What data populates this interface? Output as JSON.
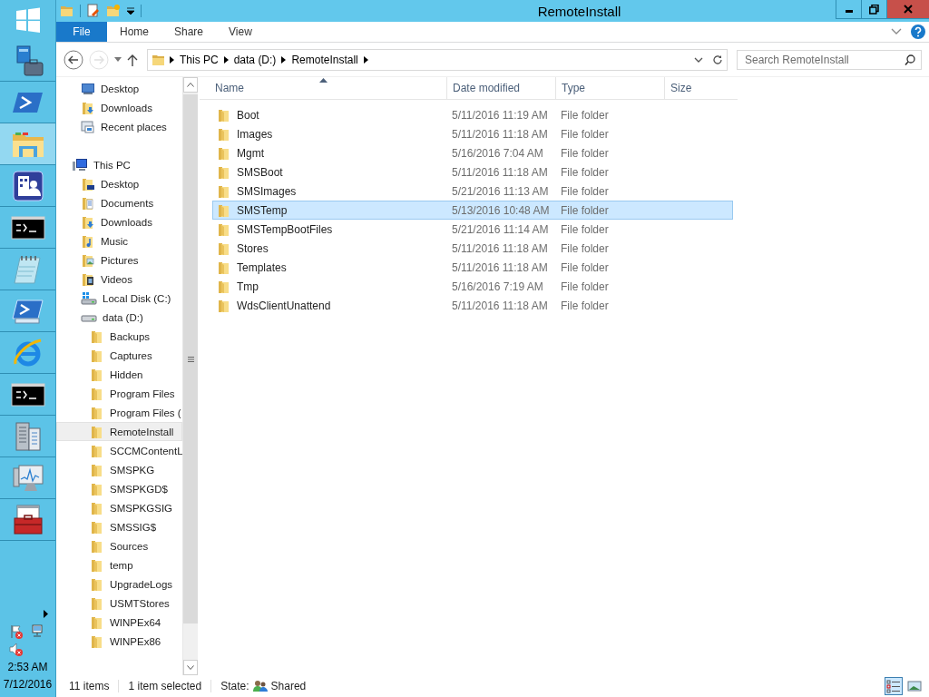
{
  "taskbar": {
    "items": [
      {
        "kind": "start",
        "selected": false
      },
      {
        "kind": "server-manager",
        "selected": false
      },
      {
        "kind": "powershell",
        "selected": false
      },
      {
        "kind": "explorer",
        "selected": true
      },
      {
        "kind": "users",
        "selected": false
      },
      {
        "kind": "cmd",
        "selected": false
      },
      {
        "kind": "notepad",
        "selected": false
      },
      {
        "kind": "powershell-ise",
        "selected": false
      },
      {
        "kind": "browser",
        "selected": false
      },
      {
        "kind": "cmd",
        "selected": false
      },
      {
        "kind": "server",
        "selected": false
      },
      {
        "kind": "monitor",
        "selected": false
      },
      {
        "kind": "toolbox",
        "selected": false
      }
    ],
    "tray": {
      "time": "2:53 AM",
      "date": "7/12/2016"
    }
  },
  "window": {
    "title": "RemoteInstall"
  },
  "ribbon": {
    "tabs": [
      {
        "label": "File",
        "kind": "file",
        "selected": false
      },
      {
        "label": "Home",
        "kind": "tab",
        "selected": false
      },
      {
        "label": "Share",
        "kind": "tab",
        "selected": false
      },
      {
        "label": "View",
        "kind": "tab",
        "selected": false
      }
    ]
  },
  "address": {
    "nav_buttons": [
      {
        "kind": "back",
        "disabled": false
      },
      {
        "kind": "forward",
        "disabled": true
      },
      {
        "kind": "recent",
        "disabled": false
      },
      {
        "kind": "up",
        "disabled": false
      }
    ],
    "breadcrumbs": [
      "This PC",
      "data (D:)",
      "RemoteInstall"
    ],
    "search": {
      "placeholder": "Search RemoteInstall"
    }
  },
  "navigation": {
    "quick_items": [
      {
        "label": "Desktop",
        "kind": "desktop",
        "selected": false
      },
      {
        "label": "Downloads",
        "kind": "downloads",
        "selected": false
      },
      {
        "label": "Recent places",
        "kind": "recent",
        "selected": false
      }
    ],
    "tree": [
      {
        "label": "This PC",
        "kind": "pc",
        "selected": false,
        "children": [
          {
            "label": "Desktop",
            "kind": "desktop-folder",
            "selected": false
          },
          {
            "label": "Documents",
            "kind": "documents",
            "selected": false
          },
          {
            "label": "Downloads",
            "kind": "downloads",
            "selected": false
          },
          {
            "label": "Music",
            "kind": "music",
            "selected": false
          },
          {
            "label": "Pictures",
            "kind": "pictures",
            "selected": false
          },
          {
            "label": "Videos",
            "kind": "videos",
            "selected": false
          },
          {
            "label": "Local Disk (C:)",
            "kind": "system-drive",
            "selected": false
          },
          {
            "label": "data (D:)",
            "kind": "drive",
            "selected": false,
            "children": [
              {
                "label": "Backups",
                "kind": "folder",
                "selected": false
              },
              {
                "label": "Captures",
                "kind": "folder",
                "selected": false
              },
              {
                "label": "Hidden",
                "kind": "folder",
                "selected": false
              },
              {
                "label": "Program Files",
                "kind": "folder",
                "selected": false
              },
              {
                "label": "Program Files (",
                "kind": "folder",
                "selected": false
              },
              {
                "label": "RemoteInstall",
                "kind": "folder",
                "selected": true
              },
              {
                "label": "SCCMContentL",
                "kind": "folder",
                "selected": false
              },
              {
                "label": "SMSPKG",
                "kind": "folder",
                "selected": false
              },
              {
                "label": "SMSPKGD$",
                "kind": "folder",
                "selected": false
              },
              {
                "label": "SMSPKGSIG",
                "kind": "folder",
                "selected": false
              },
              {
                "label": "SMSSIG$",
                "kind": "folder",
                "selected": false
              },
              {
                "label": "Sources",
                "kind": "folder",
                "selected": false
              },
              {
                "label": "temp",
                "kind": "folder",
                "selected": false
              },
              {
                "label": "UpgradeLogs",
                "kind": "folder",
                "selected": false
              },
              {
                "label": "USMTStores",
                "kind": "folder",
                "selected": false
              },
              {
                "label": "WINPEx64",
                "kind": "folder",
                "selected": false
              },
              {
                "label": "WINPEx86",
                "kind": "folder",
                "selected": false
              }
            ]
          }
        ]
      }
    ]
  },
  "file_list": {
    "columns": [
      {
        "label": "Name",
        "sorted": true
      },
      {
        "label": "Date modified",
        "sorted": false
      },
      {
        "label": "Type",
        "sorted": false
      },
      {
        "label": "Size",
        "sorted": false
      }
    ],
    "rows": [
      {
        "name": "Boot",
        "date_modified": "5/11/2016 11:19 AM",
        "type": "File folder",
        "selected": false
      },
      {
        "name": "Images",
        "date_modified": "5/11/2016 11:18 AM",
        "type": "File folder",
        "selected": false
      },
      {
        "name": "Mgmt",
        "date_modified": "5/16/2016 7:04 AM",
        "type": "File folder",
        "selected": false
      },
      {
        "name": "SMSBoot",
        "date_modified": "5/11/2016 11:18 AM",
        "type": "File folder",
        "selected": false
      },
      {
        "name": "SMSImages",
        "date_modified": "5/21/2016 11:13 AM",
        "type": "File folder",
        "selected": false
      },
      {
        "name": "SMSTemp",
        "date_modified": "5/13/2016 10:48 AM",
        "type": "File folder",
        "selected": true
      },
      {
        "name": "SMSTempBootFiles",
        "date_modified": "5/21/2016 11:14 AM",
        "type": "File folder",
        "selected": false
      },
      {
        "name": "Stores",
        "date_modified": "5/11/2016 11:18 AM",
        "type": "File folder",
        "selected": false
      },
      {
        "name": "Templates",
        "date_modified": "5/11/2016 11:18 AM",
        "type": "File folder",
        "selected": false
      },
      {
        "name": "Tmp",
        "date_modified": "5/16/2016 7:19 AM",
        "type": "File folder",
        "selected": false
      },
      {
        "name": "WdsClientUnattend",
        "date_modified": "5/11/2016 11:18 AM",
        "type": "File folder",
        "selected": false
      }
    ]
  },
  "status_bar": {
    "item_count": "11 items",
    "selection": "1 item selected",
    "state_label": "State:",
    "state_value": "Shared",
    "views": [
      {
        "kind": "details",
        "selected": true
      },
      {
        "kind": "large-icons",
        "selected": false
      }
    ]
  }
}
